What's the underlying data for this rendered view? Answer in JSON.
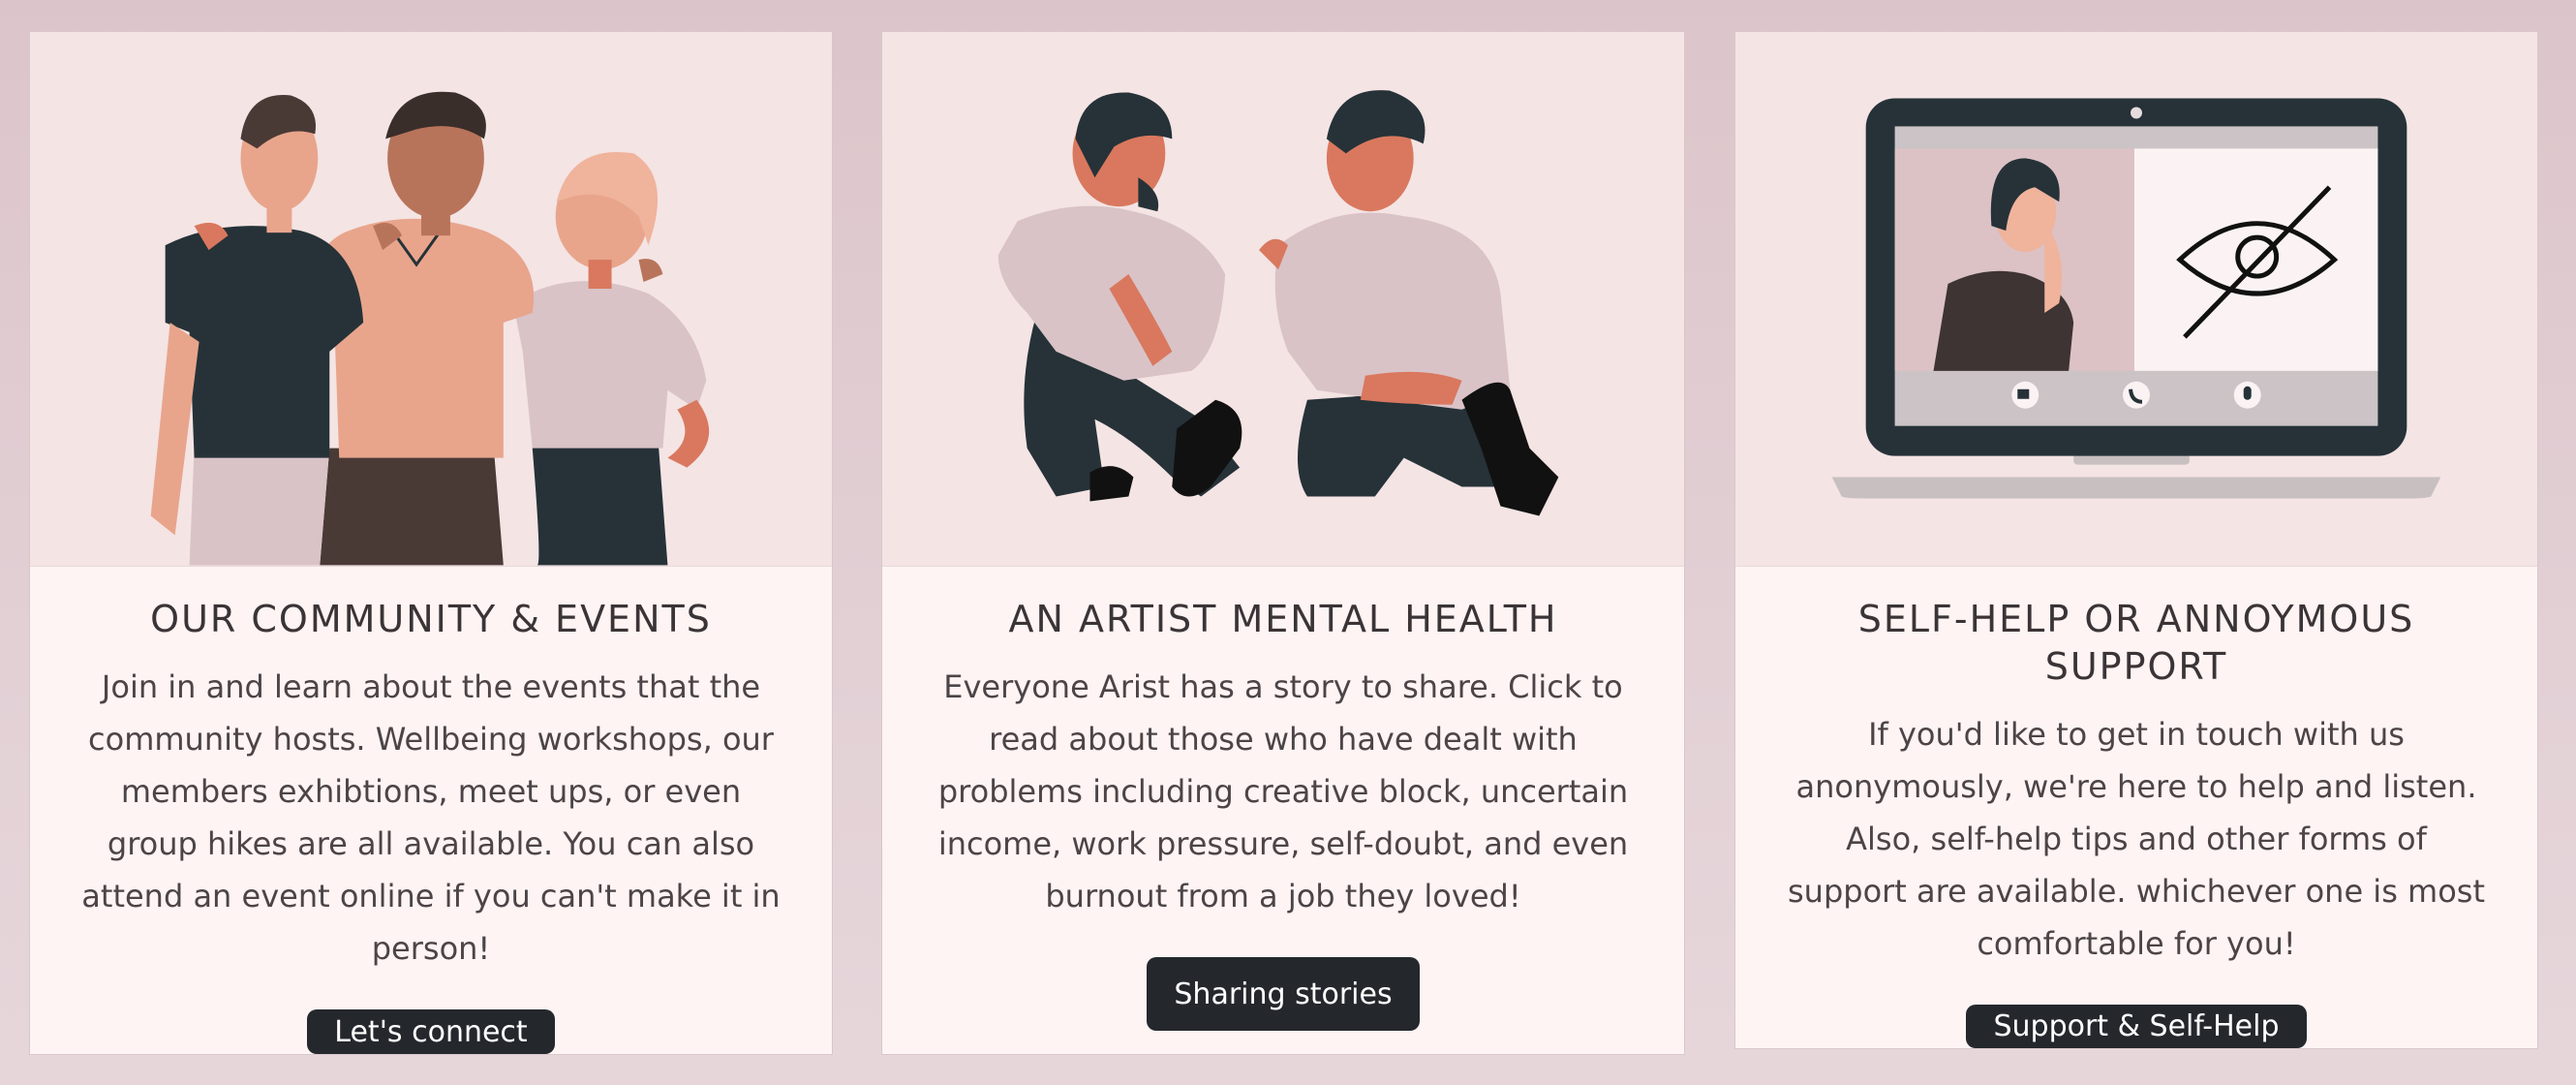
{
  "cards": [
    {
      "illustration": "three-friends-illustration",
      "title": "OUR COMMUNITY & EVENTS",
      "description": "Join in and learn about the events that the community hosts. Wellbeing workshops, our members exhibtions, meet ups, or even group hikes are all available. You can also attend an event online if you can't make it in person!",
      "button_label": "Let's connect"
    },
    {
      "illustration": "two-men-sitting-talking-illustration",
      "title": "AN ARTIST MENTAL HEALTH",
      "description": "Everyone Arist has a story to share. Click to read about those who have dealt with problems including creative block, uncertain income, work pressure, self-doubt, and even burnout from a job they loved!",
      "button_label": "Sharing stories"
    },
    {
      "illustration": "laptop-video-call-illustration",
      "title": "SELF-HELP OR ANNOYMOUS SUPPORT",
      "description": "If you'd like to get in touch with us anonymously, we're here to help and listen. Also, self-help tips and other forms of support are available. whichever one is most comfortable for you!",
      "button_label": "Support & Self-Help"
    }
  ],
  "colors": {
    "background": "#dec9ce",
    "card": "#fdf4f3",
    "illustration_bg": "#f4e4e4",
    "button": "#24282d",
    "button_text": "#ffffff",
    "text": "#4c4446",
    "dark_figure": "#263238",
    "skin_peach": "#e8a58c",
    "skin_rust": "#d9785e",
    "light_shirt": "#d9c3c7"
  }
}
